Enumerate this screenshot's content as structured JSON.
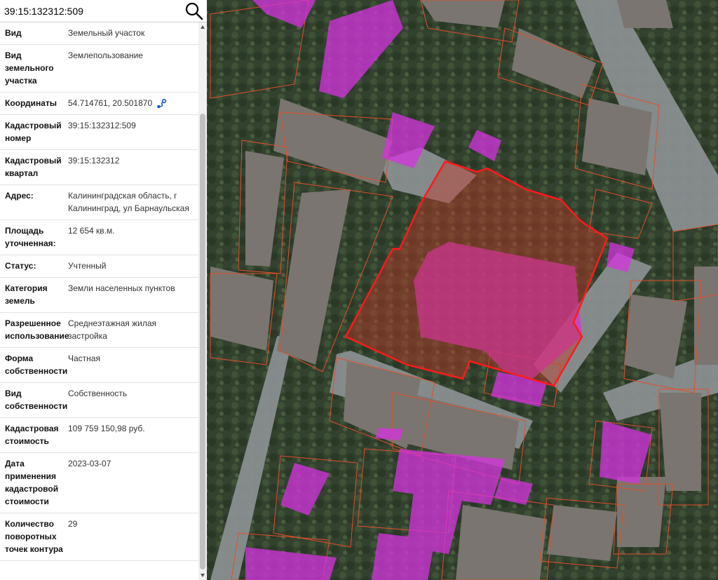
{
  "search": {
    "value": "39:15:132312:509",
    "button_icon": "search-icon"
  },
  "parcel": {
    "rows": [
      {
        "label": "Вид",
        "value": "Земельный участок"
      },
      {
        "label": "Вид земельного участка",
        "value": "Землепользование"
      },
      {
        "label": "Координаты",
        "value": "54.714761, 20.501870",
        "icon": "route-icon"
      },
      {
        "label": "Кадастровый номер",
        "value": "39:15:132312:509"
      },
      {
        "label": "Кадастровый квартал",
        "value": "39:15:132312"
      },
      {
        "label": "Адрес:",
        "value": "Калининградская область, г Калининград, ул Барнаульская"
      },
      {
        "label": "Площадь уточненная:",
        "value": "12 654 кв.м."
      },
      {
        "label": "Статус:",
        "value": "Учтенный"
      },
      {
        "label": "Категория земель",
        "value": "Земли населенных пунктов"
      },
      {
        "label": "Разрешенное использование",
        "value": "Среднеэтажная жилая застройка"
      },
      {
        "label": "Форма собственности",
        "value": "Частная"
      },
      {
        "label": "Вид собственности",
        "value": "Собственность"
      },
      {
        "label": "Кадастровая стоимость",
        "value": "109 759 150,98 руб."
      },
      {
        "label": "Дата применения кадастровой стоимости",
        "value": "2023-03-07"
      },
      {
        "label": "Количество поворотных точек контура",
        "value": "29"
      }
    ]
  },
  "colors": {
    "selected_parcel_stroke": "#ff1a1a",
    "selected_parcel_fill": "#c0392b",
    "building_fill": "#d633e0",
    "parcel_border": "#e0502a",
    "coord_icon": "#1a56d6"
  }
}
